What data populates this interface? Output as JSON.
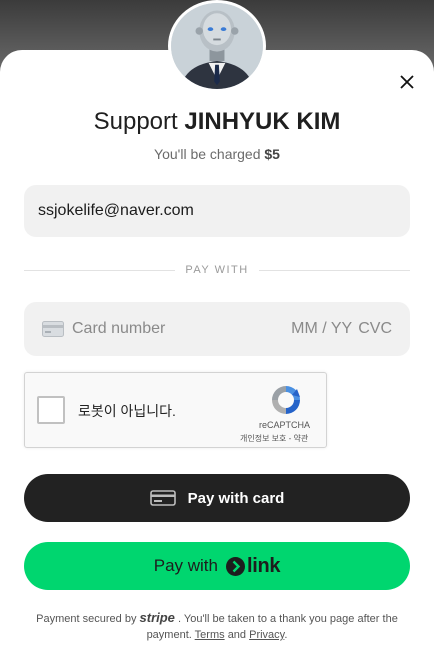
{
  "header": {
    "title_prefix": "Support",
    "creator_name": "JINHYUK KIM",
    "charge_prefix": "You'll be charged",
    "amount": "$5"
  },
  "email": {
    "value": "ssjokelife@naver.com"
  },
  "divider": {
    "label": "PAY WITH"
  },
  "card": {
    "number_placeholder": "Card number",
    "expiry_placeholder": "MM / YY",
    "cvc_placeholder": "CVC"
  },
  "captcha": {
    "label": "로봇이 아닙니다.",
    "brand": "reCAPTCHA",
    "privacy": "개인정보 보호",
    "separator": " - ",
    "terms": "약관"
  },
  "buttons": {
    "pay_card": "Pay with card",
    "pay_link_prefix": "Pay with",
    "pay_link_brand": "link"
  },
  "footer": {
    "prefix": "Payment secured by",
    "provider": "stripe",
    "middle": ". You'll be taken to a thank you page after the payment.",
    "terms": "Terms",
    "and": "and",
    "privacy": "Privacy",
    "end": "."
  },
  "colors": {
    "link_green": "#00d66f",
    "dark_button": "#222222",
    "field_bg": "#f1f1f1"
  }
}
